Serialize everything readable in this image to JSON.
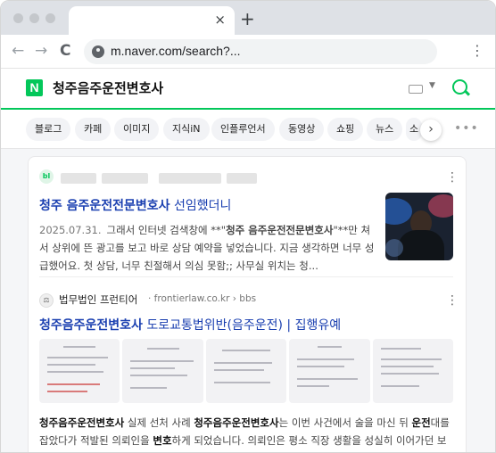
{
  "browser": {
    "tab_close": "×",
    "new_tab": "+",
    "back": "←",
    "forward": "→",
    "reload": "C",
    "url": "m.naver.com/search?...",
    "menu": "⋮"
  },
  "naver": {
    "logo": "N",
    "query": "청주음주운전변호사",
    "brand_color": "#03c75a"
  },
  "tabs": [
    "블로그",
    "카페",
    "이미지",
    "지식iN",
    "인플루언서",
    "동영상",
    "쇼핑",
    "뉴스",
    "소"
  ],
  "tab_more": "›",
  "tab_ellipsis": "•••",
  "result1": {
    "icon": "bl",
    "title_bold": "청주 음주운전전문변호사",
    "title_rest": " 선임했더니",
    "date": "2025.07.31.",
    "snippet_prefix": "그래서 인터넷 검색창에 **\"",
    "snippet_bold": "청주 음주운전전문변호사",
    "snippet_suffix": "\"**만 쳐서 상위에 뜬 광고를 보고 바로 상담 예약을 넣었습니다. 지금 생각하면 너무 성급했어요. 첫 상담, 너무 친절해서 의심 못함;; 사무실 위치는 청...",
    "menu": "⋮"
  },
  "result2": {
    "source_icon": "⚖",
    "source_name": "법무법인 프런티어",
    "source_url": "· frontierlaw.co.kr › bbs",
    "menu": "⋮",
    "title_bold": "청주음주운전변호사",
    "title_rest": " 도로교통법위반(음주운전) | 집행유예",
    "snippet": [
      {
        "t": "청주음주운전변호사",
        "b": true
      },
      {
        "t": " 실제 선처 사례 ",
        "b": false
      },
      {
        "t": "청주음주운전변호사",
        "b": true
      },
      {
        "t": "는 이번 사건에서 술을 마신 뒤 ",
        "b": false
      },
      {
        "t": "운전",
        "b": true
      },
      {
        "t": "대를 잡았다가 적발된 의뢰인을 ",
        "b": false
      },
      {
        "t": "변호",
        "b": true
      },
      {
        "t": "하게 되었습니다. 의뢰인은 평소 직장 생활을 성실히 이어가던 보통의 가장이었고, 사건 당일은 지인과의 모임에서 술을 마신 후 잡은 거...",
        "b": false
      }
    ]
  }
}
